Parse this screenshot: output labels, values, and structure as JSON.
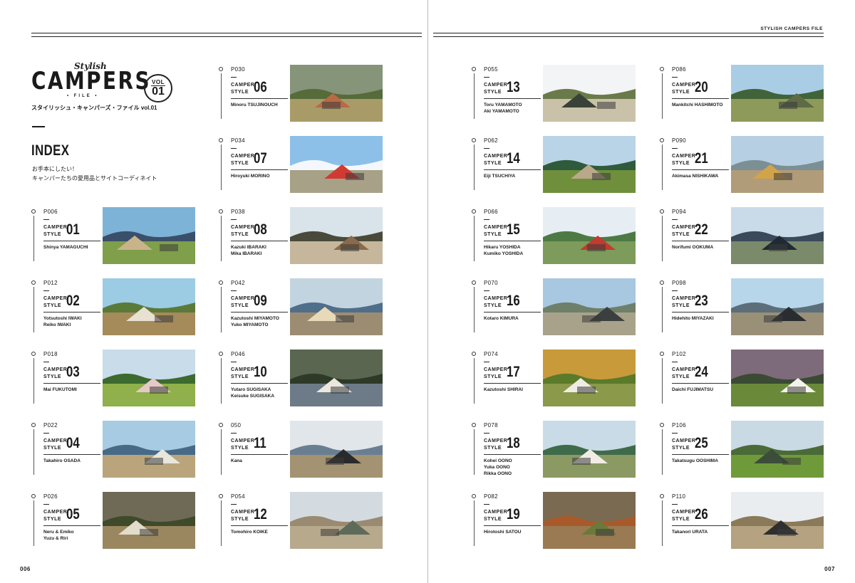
{
  "header": {
    "running_head": "STYLISH CAMPERS FILE"
  },
  "folios": {
    "left": "006",
    "right": "007"
  },
  "logo": {
    "script": "Stylish",
    "main": "CAMPERS",
    "file": "• FILE •",
    "vol_label": "VOL",
    "vol_num": "01",
    "subtitle": "スタイリッシュ・キャンパーズ・ファイル vol.01"
  },
  "index": {
    "title": "INDEX",
    "desc_line1": "お手本にしたい！",
    "desc_line2": "キャンパーたちの愛用品とサイトコーディネイト"
  },
  "camper_label": "CAMPER",
  "style_label": "STYLE",
  "entries": [
    {
      "page": "P006",
      "num": "01",
      "name": "Shinya YAMAGUCHI"
    },
    {
      "page": "P012",
      "num": "02",
      "name": "Yotsutoshi IWAKI\nReiko IWAKI"
    },
    {
      "page": "P018",
      "num": "03",
      "name": "Mai FUKUTOMI"
    },
    {
      "page": "P022",
      "num": "04",
      "name": "Takahiro OSADA"
    },
    {
      "page": "P026",
      "num": "05",
      "name": "Neru & Emiko\nYuzu & Riri"
    },
    {
      "page": "P030",
      "num": "06",
      "name": "Minoru TSUJINOUCH"
    },
    {
      "page": "P034",
      "num": "07",
      "name": "Hiroyuki MORINO"
    },
    {
      "page": "P038",
      "num": "08",
      "name": "Kazuki IBARAKI\nMika IBARAKI"
    },
    {
      "page": "P042",
      "num": "09",
      "name": "Kazutoshi MIYAMOTO\nYuko MIYAMOTO"
    },
    {
      "page": "P046",
      "num": "10",
      "name": "Yutaro SUGISAKA\nKeisuke SUGISAKA"
    },
    {
      "page": "050",
      "num": "11",
      "name": "Kana"
    },
    {
      "page": "P054",
      "num": "12",
      "name": "Tomohiro KOIKE"
    },
    {
      "page": "P055",
      "num": "13",
      "name": "Toru YAMAMOTO\nAki YAMAMOTO"
    },
    {
      "page": "P062",
      "num": "14",
      "name": "Eiji TSUCHIYA"
    },
    {
      "page": "P066",
      "num": "15",
      "name": "Hikaru YOSHIDA\nKumiko YOSHIDA"
    },
    {
      "page": "P070",
      "num": "16",
      "name": "Kotaro KIMURA"
    },
    {
      "page": "P074",
      "num": "17",
      "name": "Kazutoshi SHIRAI"
    },
    {
      "page": "P078",
      "num": "18",
      "name": "Kohei OONO\nYuka OONO\nRikka OONO"
    },
    {
      "page": "P082",
      "num": "19",
      "name": "Hirotoshi SATOU"
    },
    {
      "page": "P086",
      "num": "20",
      "name": "Mankitchi HASHIMOTO"
    },
    {
      "page": "P090",
      "num": "21",
      "name": "Akimasa NISHIKAWA"
    },
    {
      "page": "P094",
      "num": "22",
      "name": "Norifumi OOKUMA"
    },
    {
      "page": "P098",
      "num": "23",
      "name": "Hidehito MIYAZAKI"
    },
    {
      "page": "P102",
      "num": "24",
      "name": "Daichi FUJIMATSU"
    },
    {
      "page": "P106",
      "num": "25",
      "name": "Takatsugu OOSHIMA"
    },
    {
      "page": "P110",
      "num": "26",
      "name": "Takanori URATA"
    }
  ]
}
